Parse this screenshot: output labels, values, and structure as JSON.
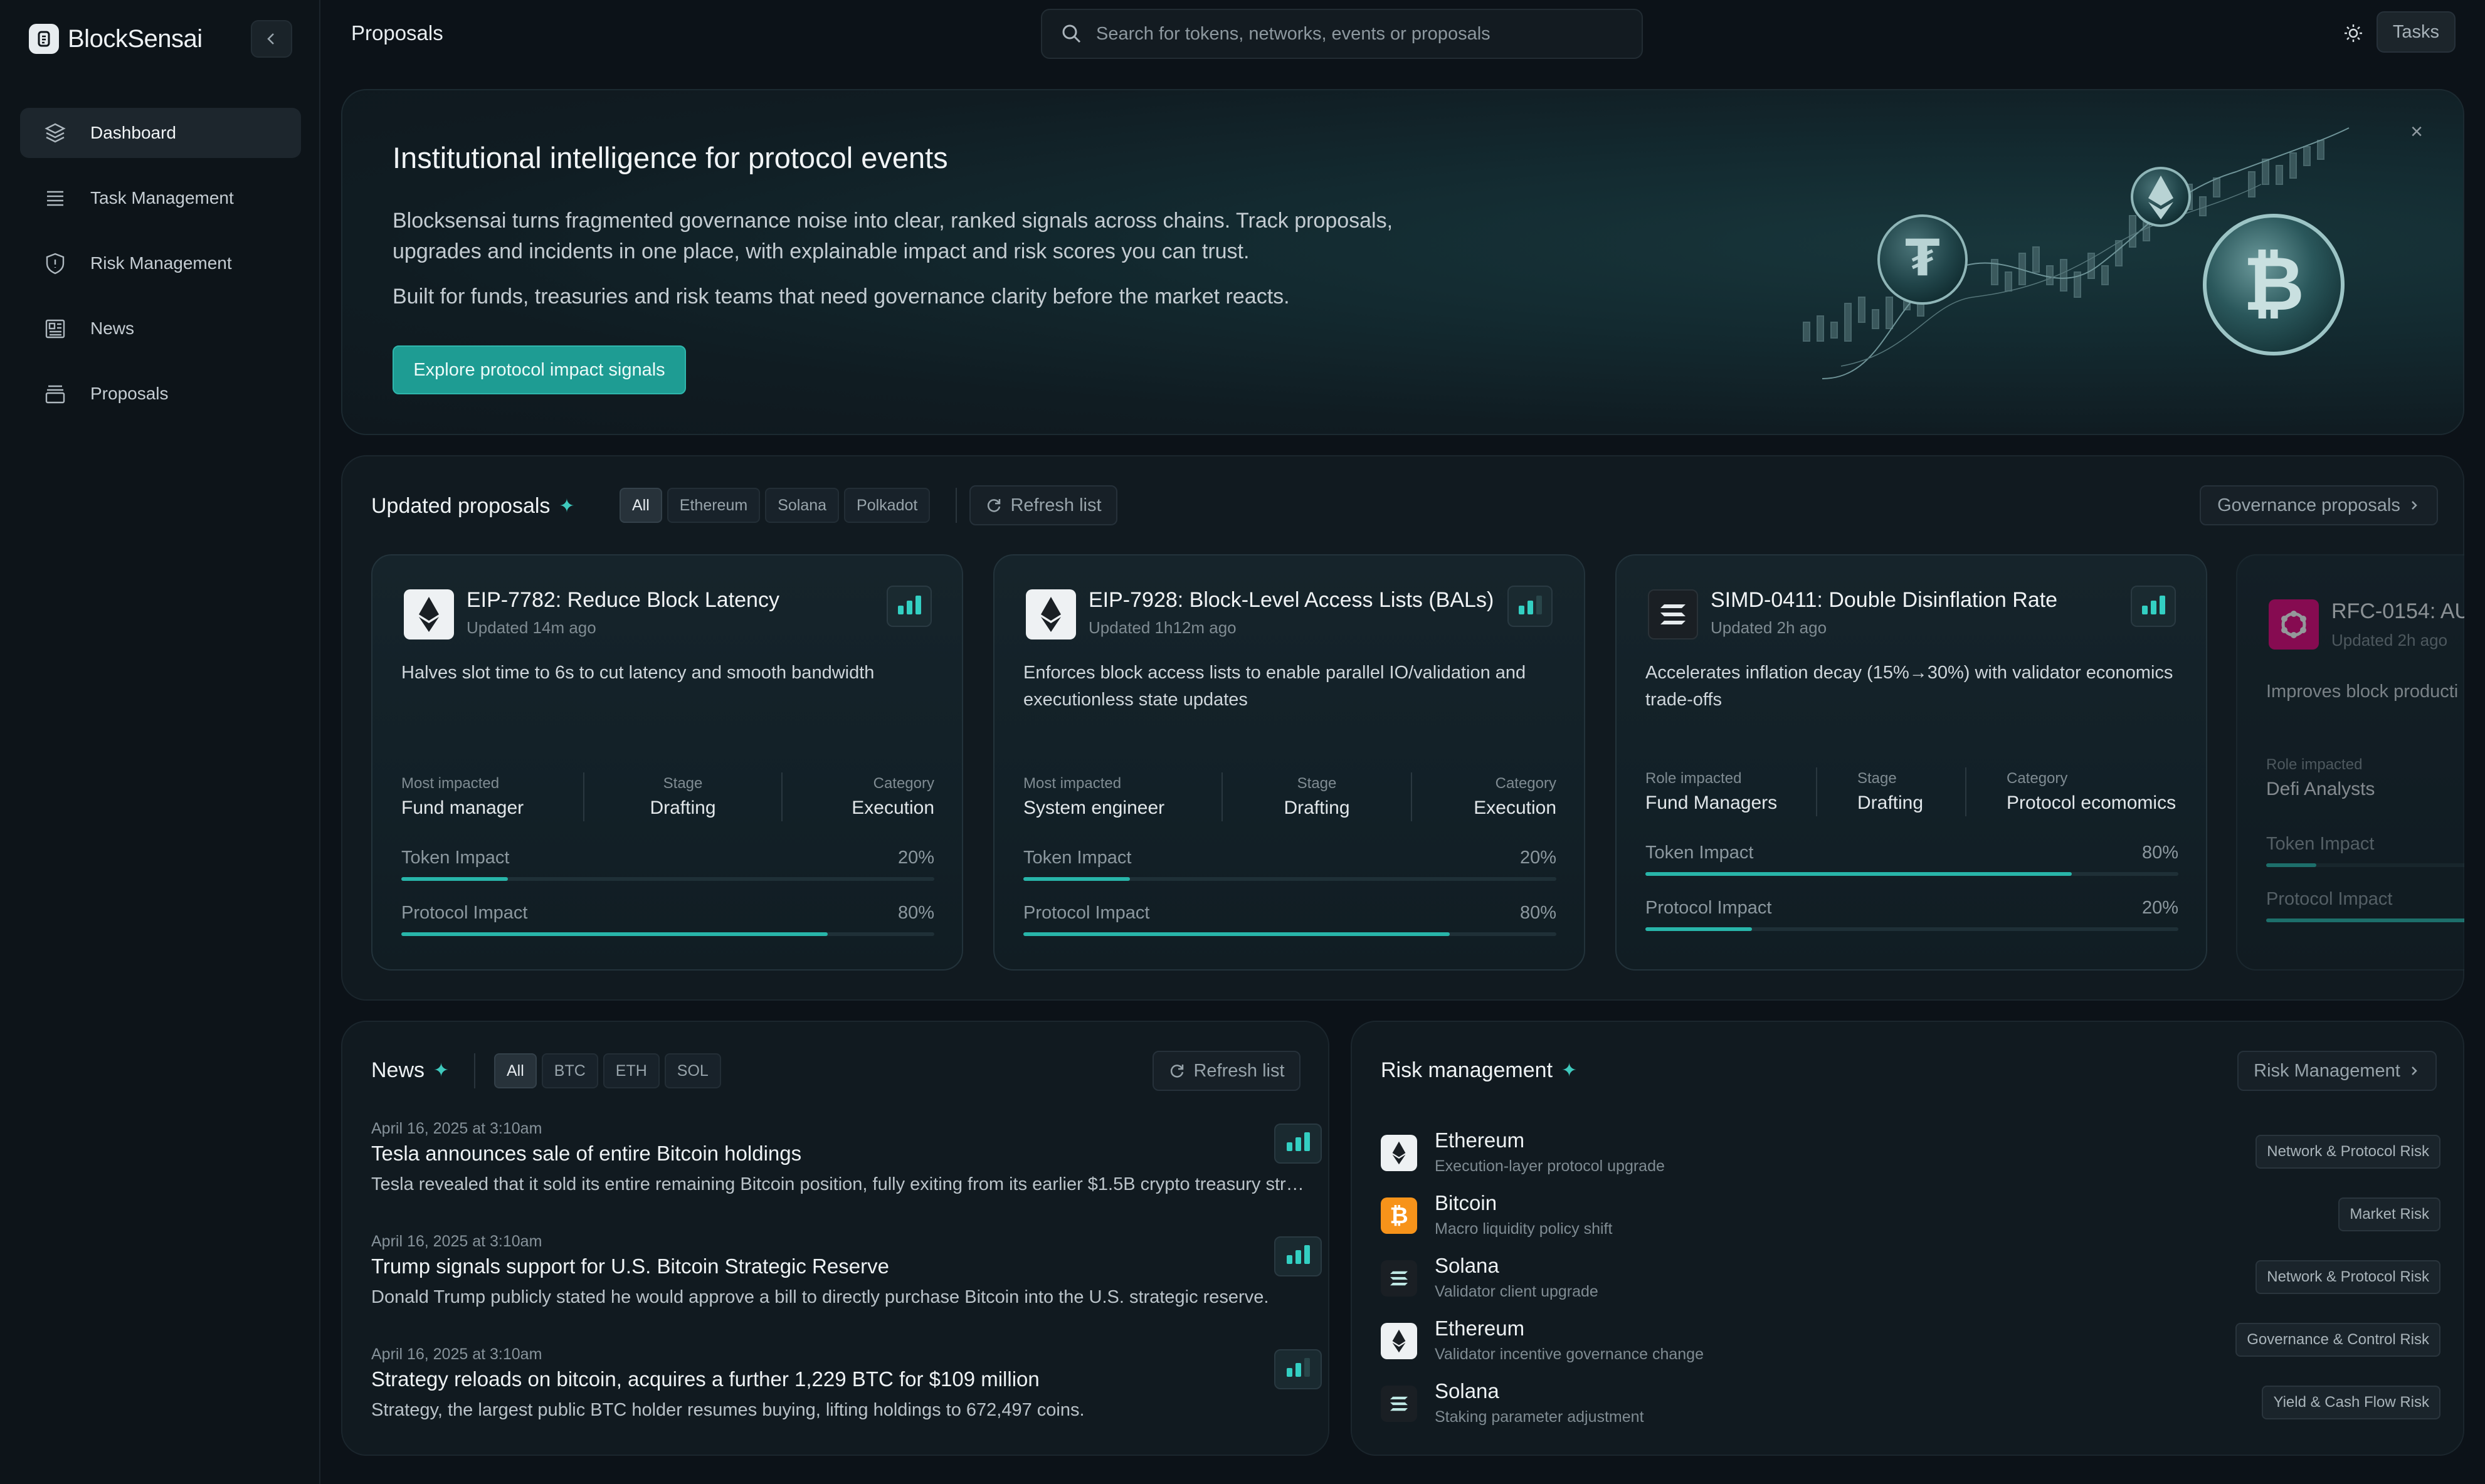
{
  "brand": {
    "name": "BlockSensai"
  },
  "sidebar": {
    "items": [
      {
        "label": "Dashboard",
        "icon": "layers-icon"
      },
      {
        "label": "Task Management",
        "icon": "list-icon"
      },
      {
        "label": "Risk Management",
        "icon": "shield-icon"
      },
      {
        "label": "News",
        "icon": "newspaper-icon"
      },
      {
        "label": "Proposals",
        "icon": "archive-icon"
      }
    ]
  },
  "header": {
    "title": "Proposals",
    "search_placeholder": "Search for tokens, networks, events or proposals",
    "tasks_label": "Tasks"
  },
  "hero": {
    "title": "Institutional intelligence for protocol events",
    "paragraph1": "Blocksensai turns fragmented governance noise into clear, ranked signals across chains. Track proposals, upgrades and incidents in one place, with explainable impact and risk scores you can trust.",
    "paragraph2": "Built for funds, treasuries and risk teams that need governance clarity before the market reacts.",
    "cta": "Explore protocol impact signals",
    "close": "×"
  },
  "proposals": {
    "title": "Updated proposals",
    "filters": [
      "All",
      "Ethereum",
      "Solana",
      "Polkadot"
    ],
    "refresh": "Refresh list",
    "link": "Governance proposals",
    "cards": [
      {
        "title": "EIP-7782: Reduce Block Latency",
        "updated": "Updated 14m ago",
        "chain": "ethereum",
        "description": "Halves slot time to 6s to cut latency and smooth bandwidth",
        "meta": [
          {
            "label": "Most impacted",
            "value": "Fund manager"
          },
          {
            "label": "Stage",
            "value": "Drafting"
          },
          {
            "label": "Category",
            "value": "Execution"
          }
        ],
        "token_label": "Token Impact",
        "token_value": "20%",
        "token_fill": 0.2,
        "protocol_label": "Protocol Impact",
        "protocol_value": "80%",
        "protocol_fill": 0.8,
        "signal_level": 3
      },
      {
        "title": "EIP-7928: Block-Level Access Lists (BALs)",
        "updated": "Updated 1h12m ago",
        "chain": "ethereum",
        "description": "Enforces block access lists to enable parallel IO/validation and executionless state updates",
        "meta": [
          {
            "label": "Most impacted",
            "value": "System engineer"
          },
          {
            "label": "Stage",
            "value": "Drafting"
          },
          {
            "label": "Category",
            "value": "Execution"
          }
        ],
        "token_label": "Token Impact",
        "token_value": "20%",
        "token_fill": 0.2,
        "protocol_label": "Protocol Impact",
        "protocol_value": "80%",
        "protocol_fill": 0.8,
        "signal_level": 2
      },
      {
        "title": "SIMD-0411: Double Disinflation Rate",
        "updated": "Updated 2h ago",
        "chain": "solana",
        "description": "Accelerates inflation decay (15%→30%) with validator economics trade-offs",
        "meta": [
          {
            "label": "Role impacted",
            "value": "Fund Managers"
          },
          {
            "label": "Stage",
            "value": "Drafting"
          },
          {
            "label": "Category",
            "value": "Protocol ecomomics"
          }
        ],
        "token_label": "Token Impact",
        "token_value": "80%",
        "token_fill": 0.8,
        "protocol_label": "Protocol Impact",
        "protocol_value": "20%",
        "protocol_fill": 0.2,
        "signal_level": 3
      },
      {
        "title": "RFC-0154: AU",
        "updated": "Updated 2h ago",
        "chain": "polkadot",
        "description": "Improves block producti",
        "meta": [
          {
            "label": "Role impacted",
            "value": "Defi Analysts"
          }
        ],
        "token_label": "Token Impact",
        "token_value": "",
        "token_fill": 0.2,
        "protocol_label": "Protocol Impact",
        "protocol_value": "",
        "protocol_fill": 0.8,
        "signal_level": 0
      }
    ]
  },
  "news": {
    "title": "News",
    "filters": [
      "All",
      "BTC",
      "ETH",
      "SOL"
    ],
    "refresh": "Refresh list",
    "items": [
      {
        "date": "April 16, 2025 at 3:10am",
        "title": "Tesla announces sale of entire Bitcoin holdings",
        "description": "Tesla revealed that it sold its entire remaining Bitcoin position, fully exiting from its earlier $1.5B crypto treasury strategy.",
        "signal_level": 3
      },
      {
        "date": "April 16, 2025 at 3:10am",
        "title": "Trump signals support for U.S. Bitcoin Strategic Reserve",
        "description": "Donald Trump publicly stated he would approve a bill to directly purchase Bitcoin into the U.S. strategic reserve.",
        "signal_level": 3
      },
      {
        "date": "April 16, 2025 at 3:10am",
        "title": "Strategy reloads on bitcoin, acquires a further 1,229 BTC for $109 million",
        "description": "Strategy, the largest public BTC holder resumes buying, lifting holdings to 672,497 coins.",
        "signal_level": 2
      }
    ]
  },
  "risk": {
    "title": "Risk management",
    "link": "Risk Management",
    "items": [
      {
        "name": "Ethereum",
        "subtitle": "Execution-layer protocol upgrade",
        "tag": "Network & Protocol Risk",
        "chain": "ethereum"
      },
      {
        "name": "Bitcoin",
        "subtitle": "Macro liquidity policy shift",
        "tag": "Market Risk",
        "chain": "bitcoin"
      },
      {
        "name": "Solana",
        "subtitle": "Validator client upgrade",
        "tag": "Network & Protocol Risk",
        "chain": "solana"
      },
      {
        "name": "Ethereum",
        "subtitle": "Validator incentive governance change",
        "tag": "Governance & Control Risk",
        "chain": "ethereum"
      },
      {
        "name": "Solana",
        "subtitle": "Staking parameter adjustment",
        "tag": "Yield & Cash Flow Risk",
        "chain": "solana"
      }
    ]
  },
  "colors": {
    "accent": "#28b5a9",
    "cta": "#1e9c93",
    "bitcoin": "#f7931a",
    "polkadot": "#e6007a"
  }
}
